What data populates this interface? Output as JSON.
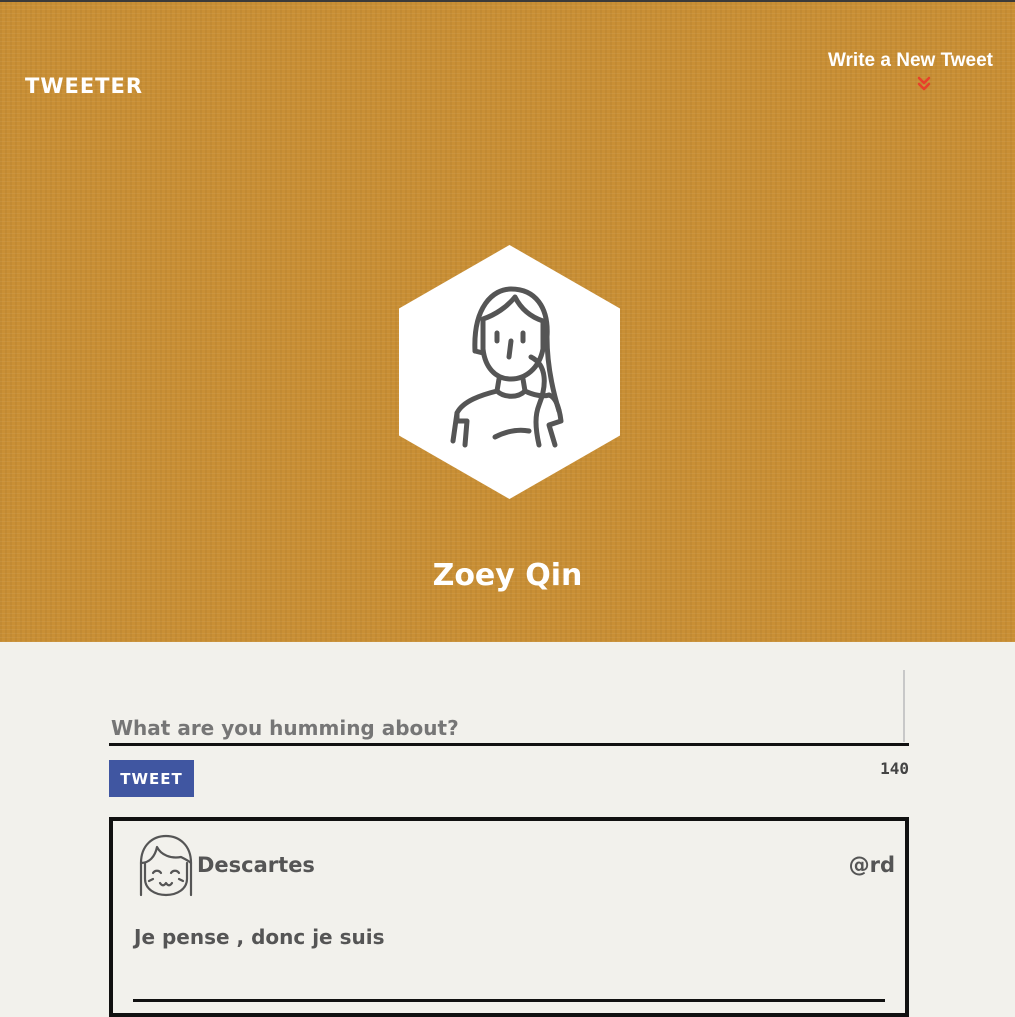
{
  "nav": {
    "brand": "TWEETER",
    "compose_link": "Write a New Tweet",
    "compose_icon": "double-chevron-down-icon",
    "compose_icon_color": "#e8402a"
  },
  "profile": {
    "name": "Zoey Qin",
    "avatar_icon": "user-avatar-icon"
  },
  "compose": {
    "placeholder": "What are you humming about?",
    "value": "",
    "submit_label": "TWEET",
    "char_count": "140"
  },
  "tweets": [
    {
      "avatar_icon": "user-avatar-icon",
      "name": "Descartes",
      "handle": "@rd",
      "text": "Je pense , donc je suis"
    }
  ],
  "colors": {
    "header_bg": "#c98f35",
    "page_bg": "#f2f1ec",
    "button_bg": "#4056a1",
    "text": "#555555"
  }
}
